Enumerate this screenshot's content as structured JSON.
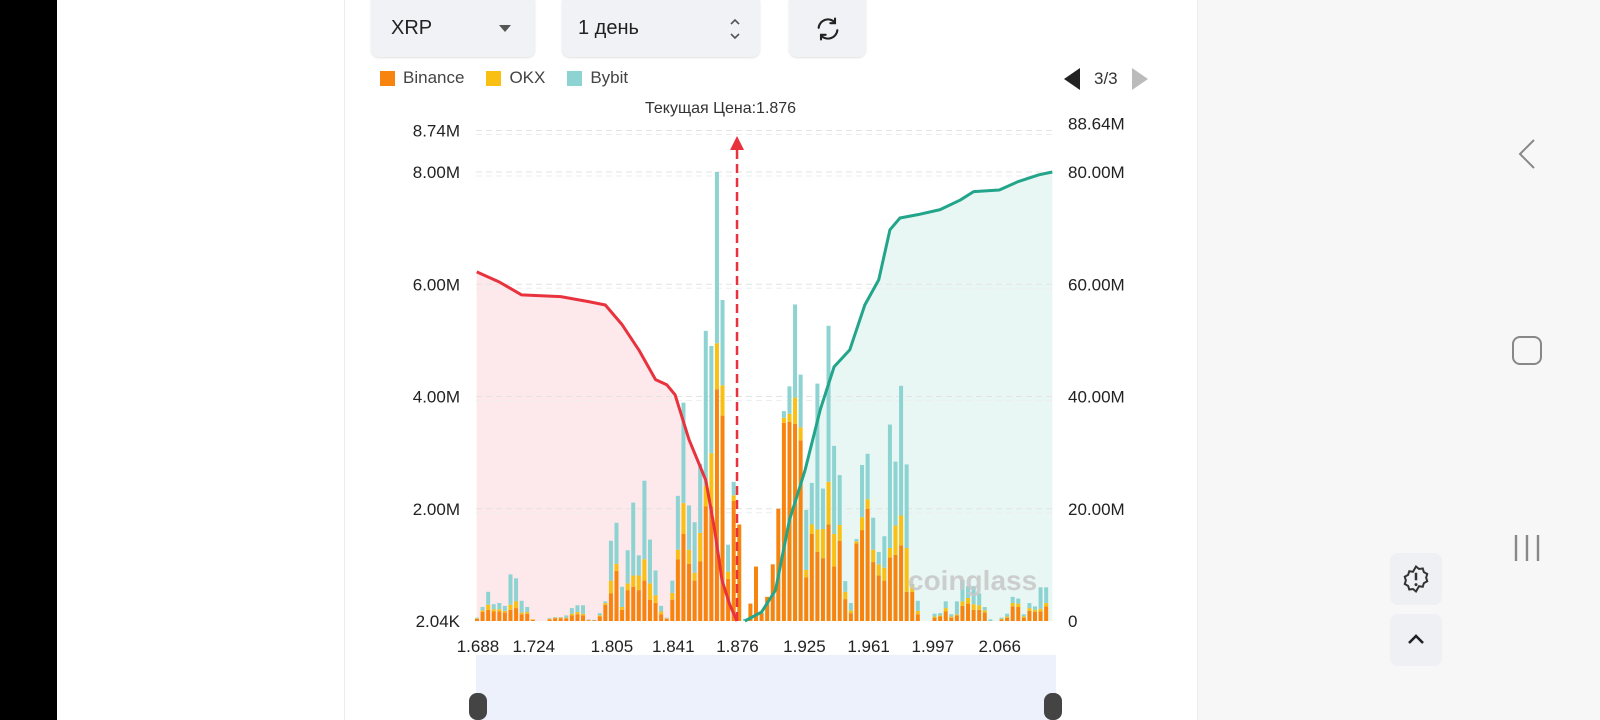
{
  "controls": {
    "coin_select": "XRP",
    "period_select": "1 день",
    "refresh_icon": "refresh-icon"
  },
  "pager": {
    "label": "3/3"
  },
  "chart_data": {
    "type": "bar",
    "stacked": true,
    "current_price_label": "Текущая Цена:1.876",
    "current_price_index": 46.6,
    "legend": [
      {
        "name": "Binance",
        "color": "#f7840f"
      },
      {
        "name": "OKX",
        "color": "#f9c013"
      },
      {
        "name": "Bybit",
        "color": "#8dd3d2"
      }
    ],
    "x_ticks": [
      {
        "index": 0,
        "label": "1.688"
      },
      {
        "index": 10,
        "label": "1.724"
      },
      {
        "index": 24,
        "label": "1.805"
      },
      {
        "index": 35,
        "label": "1.841"
      },
      {
        "index": 46.5,
        "label": "1.876"
      },
      {
        "index": 58.5,
        "label": "1.925"
      },
      {
        "index": 70,
        "label": "1.961"
      },
      {
        "index": 81.5,
        "label": "1.997"
      },
      {
        "index": 93.5,
        "label": "2.066"
      }
    ],
    "y_left": {
      "unit": "M",
      "ylim": [
        0,
        8.74
      ],
      "ticks": [
        {
          "v": 8.74,
          "label": "8.74M"
        },
        {
          "v": 8,
          "label": "8.00M"
        },
        {
          "v": 6,
          "label": "6.00M"
        },
        {
          "v": 4,
          "label": "4.00M"
        },
        {
          "v": 2,
          "label": "2.00M"
        },
        {
          "v": 0,
          "label": "2.04K"
        }
      ]
    },
    "y_right": {
      "unit": "M",
      "ylim": [
        0,
        88.64
      ],
      "ticks": [
        {
          "v": 88.64,
          "label": "88.64M"
        },
        {
          "v": 80,
          "label": "80.00M"
        },
        {
          "v": 60,
          "label": "60.00M"
        },
        {
          "v": 40,
          "label": "40.00M"
        },
        {
          "v": 20,
          "label": "20.00M"
        },
        {
          "v": 0,
          "label": "0"
        }
      ]
    },
    "grid": true,
    "series": [
      {
        "name": "Binance",
        "values": [
          0.04,
          0.16,
          0.2,
          0.17,
          0.17,
          0.15,
          0.2,
          0.23,
          0.12,
          0.13,
          0.02,
          0,
          0,
          0.03,
          0.05,
          0.05,
          0.05,
          0.1,
          0.12,
          0.1,
          0.01,
          0.01,
          0.08,
          0.29,
          0.49,
          0.89,
          0.2,
          0.55,
          0.61,
          0.55,
          0.72,
          0.38,
          0.32,
          0.12,
          0.04,
          0.38,
          1.1,
          1.55,
          1.02,
          0.72,
          1.06,
          2.04,
          2.04,
          4.13,
          3.66,
          0.75,
          2.14,
          1.72,
          0,
          0.31,
          0.97,
          0.14,
          0.43,
          1.01,
          2.0,
          3.53,
          3.55,
          3.51,
          3.22,
          0.78,
          1.55,
          1.23,
          1.12,
          1.72,
          0.97,
          1.43,
          0.39,
          0.14,
          1.38,
          1.62,
          2.0,
          1.05,
          0.81,
          0.72,
          1.13,
          1.18,
          1.35,
          0.52,
          0.52,
          0.12,
          0,
          0,
          0.06,
          0.08,
          0.17,
          0.06,
          0.1,
          0.27,
          0.31,
          0.2,
          0.2,
          0.15,
          0,
          0,
          0.03,
          0.06,
          0.26,
          0.25,
          0.06,
          0.18,
          0.16,
          0.17,
          0.26
        ]
      },
      {
        "name": "OKX",
        "values": [
          0.01,
          0.03,
          0.09,
          0.04,
          0.04,
          0.03,
          0.09,
          0.12,
          0.03,
          0.03,
          0.01,
          0,
          0,
          0.01,
          0.01,
          0.01,
          0.01,
          0.03,
          0.04,
          0.03,
          0.01,
          0,
          0.02,
          0.03,
          0.23,
          0.13,
          0.05,
          0.12,
          0.2,
          0.26,
          0.38,
          0.29,
          0.14,
          0.05,
          0.01,
          0.12,
          0.17,
          0.55,
          0.25,
          0.14,
          0.51,
          0.37,
          0.95,
          0.82,
          0.54,
          0.13,
          0.1,
          0,
          0,
          0,
          0,
          0,
          0,
          0,
          0,
          0.09,
          0.14,
          0.47,
          0.23,
          0.13,
          0.17,
          0.4,
          0.52,
          0.76,
          0.58,
          0.28,
          0.13,
          0.05,
          0.04,
          0.23,
          0.17,
          0.22,
          0.2,
          0.23,
          0.17,
          0.52,
          0.53,
          0.78,
          0.12,
          0.06,
          0,
          0,
          0.02,
          0.02,
          0.06,
          0.02,
          0.02,
          0.08,
          0.1,
          0.1,
          0.08,
          0.04,
          0,
          0,
          0.01,
          0.02,
          0.06,
          0.06,
          0.02,
          0.05,
          0.04,
          0.05,
          0.06
        ]
      },
      {
        "name": "Bybit",
        "values": [
          0.01,
          0.06,
          0.23,
          0.09,
          0.11,
          0.09,
          0.54,
          0.41,
          0.21,
          0.09,
          0,
          0,
          0,
          0.01,
          0.01,
          0.01,
          0.04,
          0.1,
          0.12,
          0.15,
          0.01,
          0.01,
          0.04,
          0.03,
          0.71,
          0.73,
          0.36,
          0.59,
          1.3,
          0.36,
          1.4,
          0.78,
          0.44,
          0.1,
          0.01,
          0.22,
          0.96,
          1.79,
          0.79,
          0.9,
          1.23,
          2.76,
          1.91,
          3.05,
          1.52,
          0.48,
          0.24,
          0,
          0.04,
          0,
          0,
          0,
          0,
          0,
          0,
          0.12,
          0.49,
          1.66,
          0.94,
          1.07,
          0.74,
          2.6,
          0.72,
          2.78,
          1.57,
          0.89,
          0.19,
          0.13,
          0.04,
          0.93,
          0.81,
          0.57,
          0.22,
          0.56,
          2.2,
          1.14,
          2.31,
          1.49,
          0.02,
          0.18,
          0,
          0,
          0.05,
          0.04,
          0.12,
          0.04,
          0.23,
          0.38,
          0.21,
          0.32,
          0.21,
          0.06,
          0.03,
          0,
          0.02,
          0.05,
          0.11,
          0.09,
          0.04,
          0.09,
          0.06,
          0.38,
          0.28
        ]
      }
    ],
    "cumulative_short": {
      "color": "#e8333f",
      "axis": "right",
      "points": [
        [
          0,
          62.2
        ],
        [
          4,
          60.4
        ],
        [
          8,
          58.1
        ],
        [
          15,
          57.8
        ],
        [
          20,
          56.9
        ],
        [
          23,
          56.3
        ],
        [
          26,
          52.8
        ],
        [
          29,
          48.3
        ],
        [
          32,
          43.0
        ],
        [
          34,
          42.1
        ],
        [
          35.5,
          40.3
        ],
        [
          38,
          32.3
        ],
        [
          41,
          25.1
        ],
        [
          42.6,
          16.2
        ],
        [
          43.9,
          7.3
        ],
        [
          45.3,
          2.9
        ],
        [
          46.6,
          0
        ]
      ]
    },
    "cumulative_long": {
      "color": "#22a58a",
      "axis": "right",
      "points": [
        [
          48,
          0
        ],
        [
          51,
          1.6
        ],
        [
          53.5,
          5.5
        ],
        [
          56,
          18
        ],
        [
          58.8,
          26.9
        ],
        [
          61.5,
          37.6
        ],
        [
          64,
          45.3
        ],
        [
          66.8,
          48.3
        ],
        [
          69.5,
          56.3
        ],
        [
          72,
          60.8
        ],
        [
          74,
          69.7
        ],
        [
          75.8,
          71.8
        ],
        [
          79,
          72.4
        ],
        [
          83,
          73.3
        ],
        [
          86.6,
          75
        ],
        [
          89,
          76.5
        ],
        [
          93.6,
          76.8
        ],
        [
          97,
          78.3
        ],
        [
          100.7,
          79.5
        ],
        [
          102.8,
          80
        ]
      ]
    },
    "watermark": "coinglass"
  },
  "side_buttons": [
    "alert-badge-icon",
    "chevron-up-icon"
  ],
  "system_nav": [
    "back-icon",
    "home-icon",
    "recents-icon"
  ]
}
